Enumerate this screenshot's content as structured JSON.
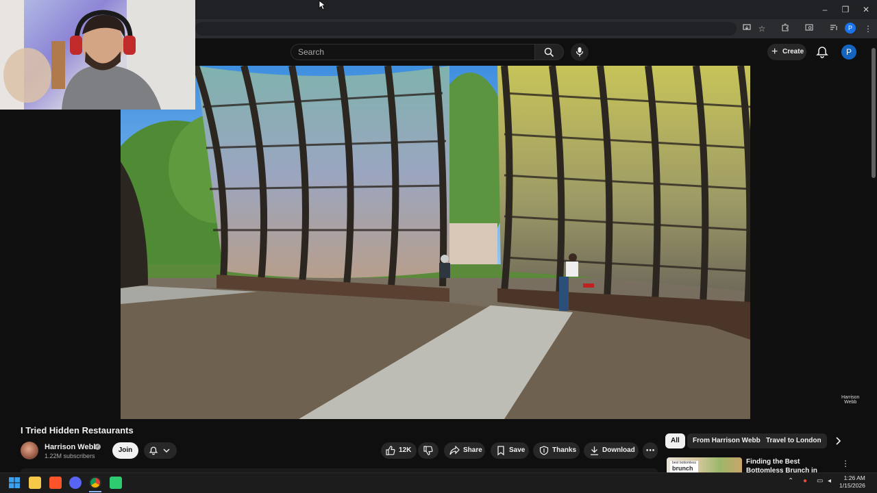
{
  "browser": {
    "window_controls": {
      "minimize": "–",
      "maximize": "❐",
      "close": "✕"
    },
    "profile_initial": "P"
  },
  "youtube": {
    "search_placeholder": "Search",
    "create_label": "Create",
    "avatar_initial": "P"
  },
  "video": {
    "title": "I Tried Hidden Restaurants",
    "watermark_line1": "Harrison",
    "watermark_line2": "Webb"
  },
  "channel": {
    "name": "Harrison Webb",
    "subscribers": "1.22M subscribers",
    "join_label": "Join"
  },
  "actions": {
    "like_count": "12K",
    "share_label": "Share",
    "save_label": "Save",
    "thanks_label": "Thanks",
    "download_label": "Download"
  },
  "chips": {
    "all": "All",
    "from_channel": "From Harrison Webb",
    "travel": "Travel to London"
  },
  "recommendation": {
    "thumb_text": "brunch",
    "thumb_small": "best bottomless",
    "title": "Finding the Best Bottomless Brunch in London"
  },
  "taskbar": {
    "time": "1:26 AM",
    "date": "1/15/2026"
  }
}
